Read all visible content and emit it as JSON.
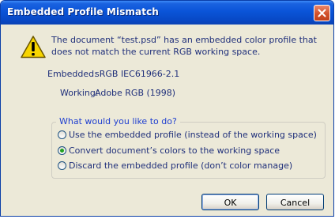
{
  "dialog": {
    "title": "Embedded Profile Mismatch",
    "message": "The document “test.psd” has an embedded color profile that does not match the current RGB working space.",
    "embedded_label": "Embedded:",
    "embedded_value": "sRGB IEC61966-2.1",
    "working_label": "Working:",
    "working_value": "Adobe RGB (1998)",
    "question": "What would you like to do?",
    "options": [
      {
        "label": "Use the embedded profile (instead of the working space)",
        "selected": false
      },
      {
        "label": "Convert document’s colors to the working space",
        "selected": true
      },
      {
        "label": "Discard the embedded profile (don’t color manage)",
        "selected": false
      }
    ],
    "ok_label": "OK",
    "cancel_label": "Cancel"
  },
  "icons": {
    "warning": "warning-icon",
    "close": "close-icon"
  },
  "colors": {
    "titlebar": "#0a54d8",
    "close_button": "#d2512a",
    "dialog_bg": "#ece9d8",
    "text": "#1f2f7a",
    "legend_text": "#1f3fd0",
    "selected_radio": "#21a121"
  }
}
